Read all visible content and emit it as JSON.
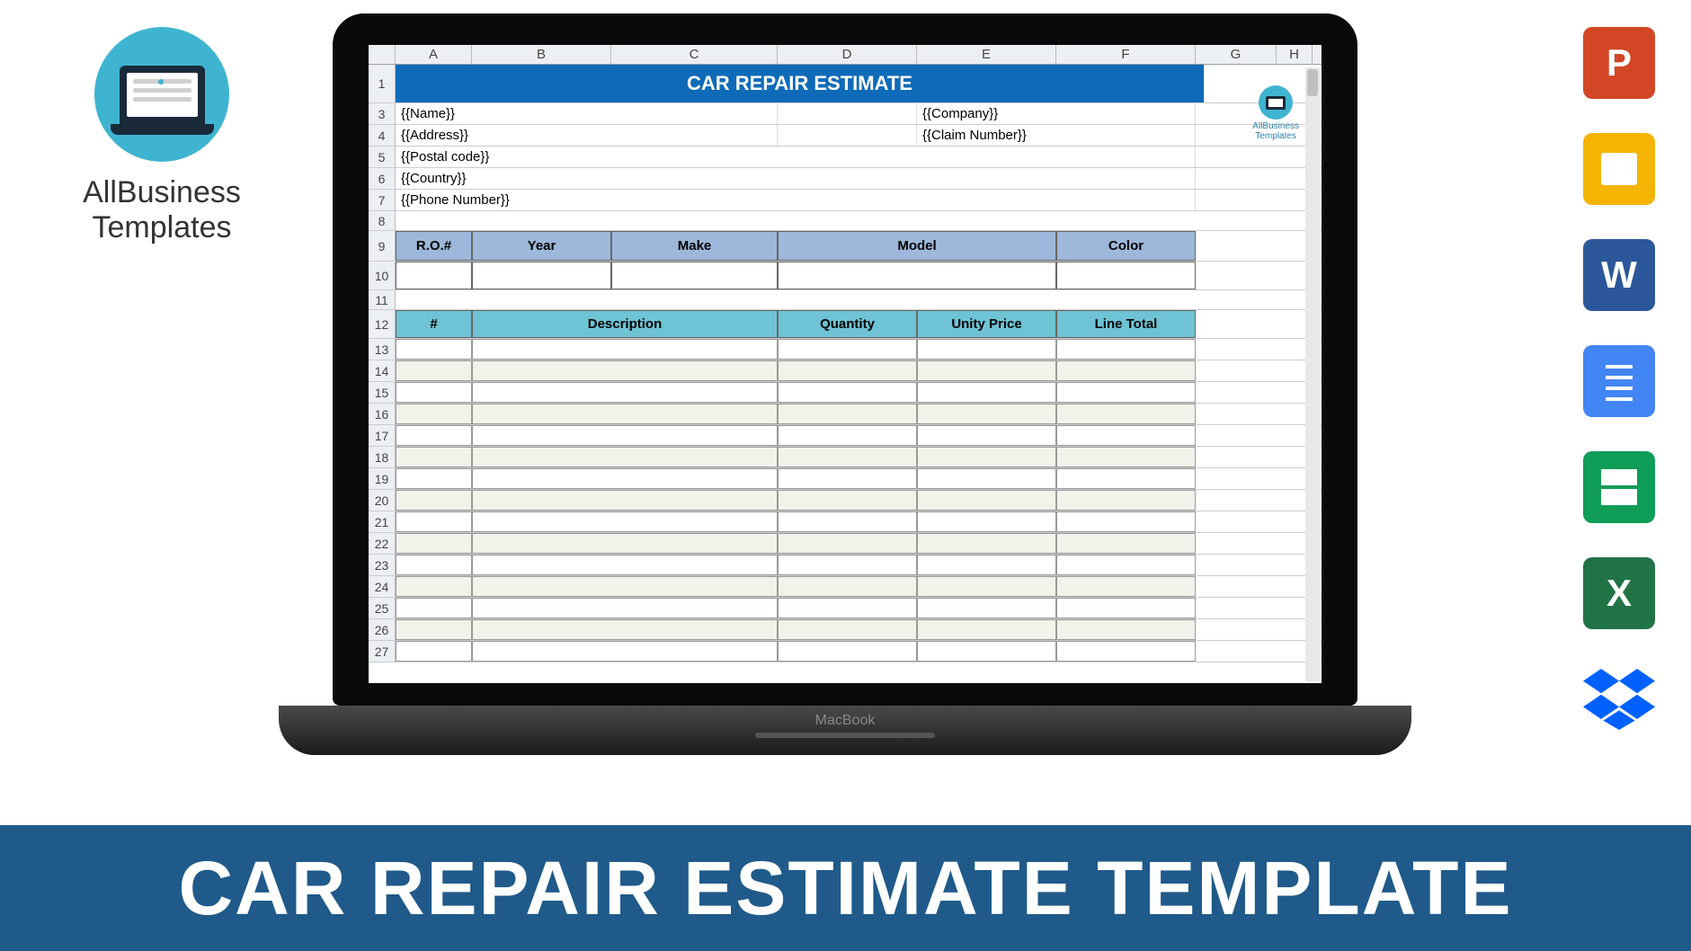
{
  "brand": {
    "line1": "AllBusiness",
    "line2": "Templates"
  },
  "apps": [
    "powerpoint",
    "google-slides",
    "word",
    "google-docs",
    "google-sheets",
    "excel",
    "dropbox"
  ],
  "spreadsheet": {
    "columns": [
      "A",
      "B",
      "C",
      "D",
      "E",
      "F",
      "G",
      "H"
    ],
    "rows": [
      1,
      3,
      4,
      5,
      6,
      7,
      8,
      9,
      10,
      11,
      12,
      13,
      14,
      15,
      16,
      17,
      18,
      19,
      20,
      21,
      22,
      23,
      24,
      25,
      26,
      27
    ],
    "title": "CAR REPAIR ESTIMATE",
    "customer": {
      "name": "{{Name}}",
      "address": "{{Address}}",
      "postal": "{{Postal code}}",
      "country": "{{Country}}",
      "phone": "{{Phone Number}}",
      "company": "{{Company}}",
      "claim": "{{Claim Number}}"
    },
    "vehicle_headers": [
      "R.O.#",
      "Year",
      "Make",
      "Model",
      "Color"
    ],
    "item_headers": [
      "#",
      "Description",
      "Quantity",
      "Unity Price",
      "Line Total"
    ],
    "watermark": "AllBusiness\nTemplates",
    "laptop_brand": "MacBook"
  },
  "footer": "CAR REPAIR ESTIMATE TEMPLATE"
}
